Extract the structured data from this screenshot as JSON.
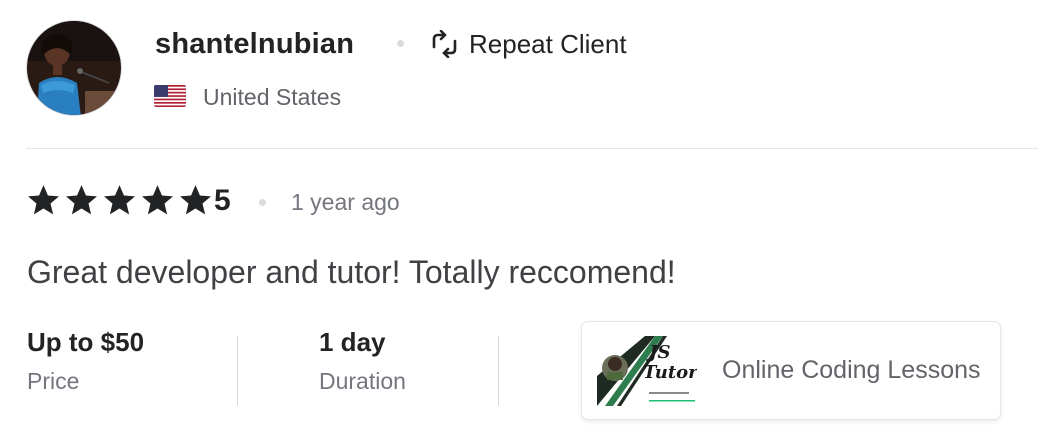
{
  "reviewer": {
    "username": "shantelnubian",
    "badge_label": "Repeat Client",
    "badge_icon": "repeat-arrows-icon",
    "country": "United States",
    "flag_icon": "us-flag-icon"
  },
  "review": {
    "rating_value": "5",
    "star_count": 5,
    "star_color": "#222325",
    "time_ago": "1 year ago",
    "text": "Great developer and tutor! Totally reccomend!"
  },
  "meta": {
    "price_value": "Up to $50",
    "price_label": "Price",
    "duration_value": "1 day",
    "duration_label": "Duration"
  },
  "gig": {
    "title": "Online Coding Lessons",
    "thumb_text_line1": "JS",
    "thumb_text_line2": "Tutor",
    "accent_color": "#1dbf73"
  }
}
